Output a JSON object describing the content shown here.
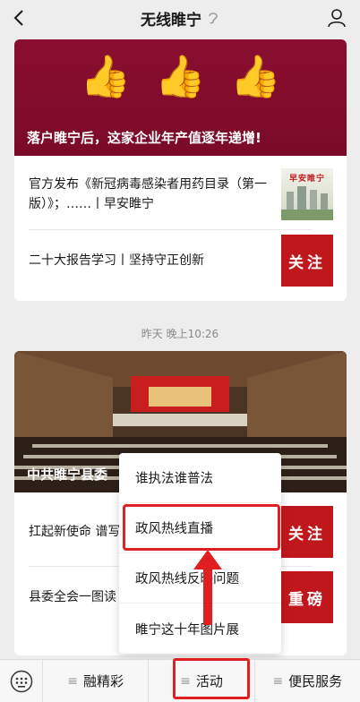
{
  "header": {
    "title": "无线睢宁"
  },
  "card1": {
    "banner_title": "落户睢宁后，这家企业年产值逐年递增!",
    "items": [
      {
        "title": "官方发布《新冠病毒感染者用药目录（第一版）》；……丨早安睢宁",
        "thumb_label": "早安睢宁"
      },
      {
        "title": "二十大报告学习丨坚持守正创新",
        "thumb_label": "关注"
      }
    ]
  },
  "timestamp": "昨天 晚上10:26",
  "card2": {
    "banner_title": "中共睢宁县委",
    "items": [
      {
        "title": "扛起新使命 谱写",
        "thumb_label": "关注"
      },
      {
        "title": "县委全会一图读",
        "thumb_label": "重磅"
      }
    ]
  },
  "popup": {
    "items": [
      "谁执法谁普法",
      "政风热线直播",
      "政风热线反映问题",
      "睢宁这十年图片展"
    ]
  },
  "bottom_bar": {
    "tabs": [
      "融精彩",
      "活动",
      "便民服务"
    ]
  },
  "colors": {
    "accent": "#e02020",
    "banner_red": "#8a0e30",
    "thumb_red": "#c0171d"
  }
}
